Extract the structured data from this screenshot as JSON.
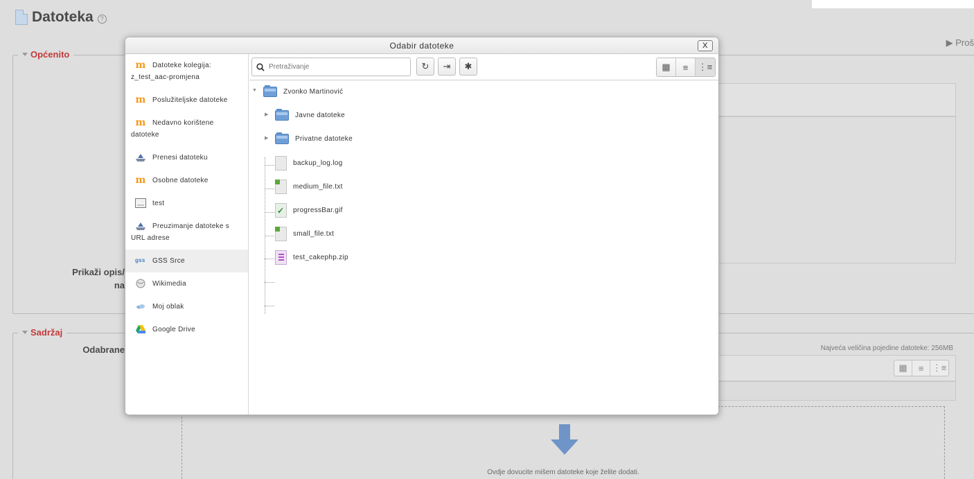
{
  "background": {
    "title": "Datoteka",
    "expand_label": "Proš",
    "section_general": "Općenito",
    "section_content": "Sadržaj",
    "label_show_desc_1": "Prikaži opis/",
    "label_show_desc_2": "na",
    "label_selected": "Odabrane",
    "max_size_text": "Najveća veličina pojedine datoteke: 256MB",
    "drop_text": "Ovdje dovucite mišem datoteke koje želite dodati."
  },
  "dialog": {
    "title": "Odabir datoteke",
    "close_label": "X",
    "search_placeholder": "Pretraživanje",
    "sidebar": [
      {
        "label": "Datoteke kolegija: z_test_aac-promjena",
        "icon": "moodle-icon"
      },
      {
        "label": "Poslužiteljske datoteke",
        "icon": "moodle-icon"
      },
      {
        "label": "Nedavno korištene datoteke",
        "icon": "moodle-icon"
      },
      {
        "label": "Prenesi datoteku",
        "icon": "upload-icon"
      },
      {
        "label": "Osobne datoteke",
        "icon": "moodle-icon"
      },
      {
        "label": "test",
        "icon": "repository-icon"
      },
      {
        "label": "Preuzimanje datoteke s URL adrese",
        "icon": "url-download-icon"
      },
      {
        "label": "GSS Srce",
        "icon": "gss-icon"
      },
      {
        "label": "Wikimedia",
        "icon": "wikimedia-icon"
      },
      {
        "label": "Moj oblak",
        "icon": "cloud-icon"
      },
      {
        "label": "Google Drive",
        "icon": "google-drive-icon"
      }
    ],
    "tree": {
      "root": "Zvonko Martinović",
      "folders": [
        "Javne datoteke",
        "Privatne datoteke"
      ],
      "files": [
        "backup_log.log",
        "medium_file.txt",
        "progressBar.gif",
        "small_file.txt",
        "test_cakephp.zip"
      ]
    }
  }
}
